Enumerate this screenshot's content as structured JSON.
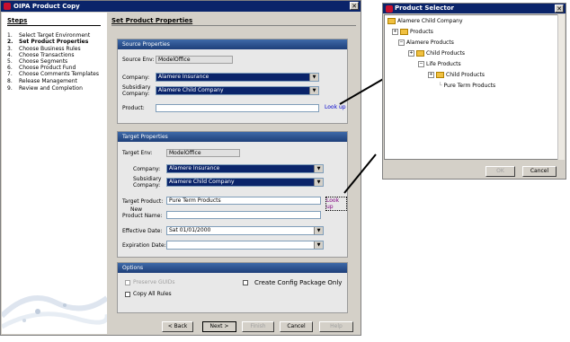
{
  "main_window": {
    "title": "OIPA  Product Copy",
    "close_glyph": "✕",
    "steps_title": "Steps",
    "steps": [
      {
        "num": "1.",
        "label": "Select Target Environment"
      },
      {
        "num": "2.",
        "label": "Set Product Properties"
      },
      {
        "num": "3.",
        "label": "Choose Business Rules"
      },
      {
        "num": "4.",
        "label": "Choose Transactions"
      },
      {
        "num": "5.",
        "label": "Choose Segments"
      },
      {
        "num": "6.",
        "label": "Choose   Product Fund"
      },
      {
        "num": "7.",
        "label": "Choose Comments Templates"
      },
      {
        "num": "8.",
        "label": "Release Management"
      },
      {
        "num": "9.",
        "label": "Review and Completion"
      }
    ],
    "page_title": "Set Product Properties",
    "source": {
      "header": "Source Properties",
      "env_label": "Source Env:",
      "env_value": "ModelOffice",
      "company_label": "Company:",
      "company_value": "Alamere Insurance",
      "subsidiary_label_1": "Subsidiary",
      "subsidiary_label_2": "Company:",
      "subsidiary_value": "Alamere Child Company",
      "product_label": "Product:",
      "product_value": "",
      "lookup": "Look up"
    },
    "target": {
      "header": "Target Properties",
      "env_label": "Target Env:",
      "env_value": "ModelOffice",
      "company_label": "Company:",
      "company_value": "Alamere Insurance",
      "subsidiary_label_1": "Subsidiary",
      "subsidiary_label_2": "Company:",
      "subsidiary_value": "Alamere Child Company",
      "product_label": "Target Product:",
      "product_value": "Pure Term Products",
      "lookup": "Look up",
      "new_name_label_1": "New",
      "new_name_label_2": "Product Name:",
      "new_name_value": "",
      "effective_label": "Effective Date:",
      "effective_value": "Sat 01/01/2000",
      "expiration_label": "Expiration Date:",
      "expiration_value": ""
    },
    "options": {
      "header": "Options",
      "preserve_guids": "Preserve GUIDs",
      "copy_all_rules": "Copy All Rules",
      "create_config": "Create Config Package Only"
    },
    "buttons": {
      "back": "< Back",
      "next": "Next >",
      "finish": "Finish",
      "cancel": "Cancel",
      "help": "Help"
    },
    "dropdown_glyph": "▼"
  },
  "product_selector": {
    "title": "Product Selector",
    "close_glyph": "✕",
    "tree": [
      {
        "label": "Alamere Child Company",
        "exp": ""
      },
      {
        "label": "Products",
        "exp": "+"
      },
      {
        "label": "Alamere Products",
        "exp": "−"
      },
      {
        "label": "Child Products",
        "exp": "+"
      },
      {
        "label": "Life Products",
        "exp": "−"
      },
      {
        "label": "Child Products",
        "exp": "+"
      },
      {
        "label": "Pure Term Products",
        "exp": ""
      }
    ],
    "ok": "OK",
    "cancel": "Cancel"
  },
  "colors": {
    "title_bar": "#0a246a",
    "panel_header": "#2a4f8c",
    "selected_field": "#0a246a"
  }
}
